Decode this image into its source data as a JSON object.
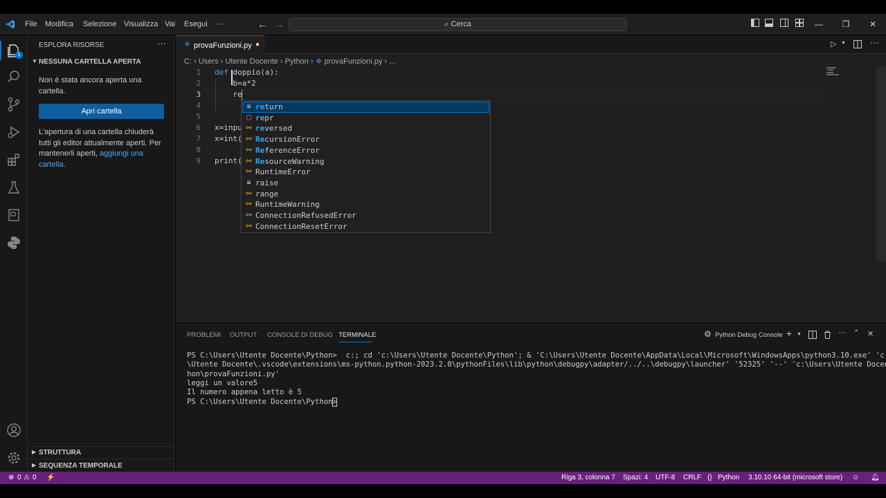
{
  "titlebar": {
    "menus": [
      "File",
      "Modifica",
      "Selezione",
      "Visualizza",
      "Vai",
      "Esegui",
      "···"
    ],
    "search_placeholder": "Cerca"
  },
  "sidebar": {
    "header": "ESPLORA RISORSE",
    "section_title": "NESSUNA CARTELLA APERTA",
    "message": "Non è stata ancora aperta una cartella.",
    "open_button": "Apri cartella",
    "note_prefix": "L'apertura di una cartella chiuderà tutti gli editor attualmente aperti. Per mantenerli aperti, ",
    "note_link": "aggiungi una cartella",
    "note_suffix": ".",
    "outline": "STRUTTURA",
    "timeline": "SEQUENZA TEMPORALE"
  },
  "editor": {
    "tab_label": "provaFunzioni.py",
    "breadcrumb": [
      "C:",
      "Users",
      "Utente Docente",
      "Python",
      "provaFunzioni.py",
      "..."
    ],
    "line_numbers": [
      "1",
      "2",
      "3",
      "4",
      "5",
      "6",
      "7",
      "8",
      "9"
    ],
    "code": {
      "l1_kw": "def",
      "l1_rest": " doppio(a):",
      "l2": "    b=a*2",
      "l3": "    re",
      "l6": "x=inpu",
      "l7": "x=int(",
      "l9": "print("
    }
  },
  "suggestions": [
    {
      "m": "re",
      "r": "turn",
      "icon": "keyword"
    },
    {
      "m": "re",
      "r": "pr",
      "icon": "function"
    },
    {
      "m": "re",
      "r": "versed",
      "icon": "class"
    },
    {
      "m": "Re",
      "r": "cursionError",
      "icon": "class"
    },
    {
      "m": "Re",
      "r": "ferenceError",
      "icon": "class"
    },
    {
      "m": "Re",
      "r": "sourceWarning",
      "icon": "class"
    },
    {
      "m": "",
      "r": "RuntimeError",
      "icon": "class"
    },
    {
      "m": "",
      "r": "raise",
      "icon": "keyword"
    },
    {
      "m": "",
      "r": "range",
      "icon": "class"
    },
    {
      "m": "",
      "r": "RuntimeWarning",
      "icon": "class"
    },
    {
      "m": "",
      "r": "ConnectionRefusedError",
      "icon": "class"
    },
    {
      "m": "",
      "r": "ConnectionResetError",
      "icon": "class"
    }
  ],
  "panel": {
    "tabs": [
      "PROBLEMI",
      "OUTPUT",
      "CONSOLE DI DEBUG",
      "TERMINALE"
    ],
    "debug_console": "Python Debug Console",
    "terminal_lines": [
      "PS C:\\Users\\Utente Docente\\Python>  c:; cd 'c:\\Users\\Utente Docente\\Python'; & 'C:\\Users\\Utente Docente\\AppData\\Local\\Microsoft\\WindowsApps\\python3.10.exe' 'c:\\Users",
      "\\Utente Docente\\.vscode\\extensions\\ms-python.python-2023.2.0\\pythonFiles\\lib\\python\\debugpy\\adapter/../..\\debugpy\\launcher' '52325' '--' 'c:\\Users\\Utente Docente\\Pyt",
      "hon\\provaFunzioni.py'",
      "leggi un valore5",
      "Il numero appena letto è 5",
      "PS C:\\Users\\Utente Docente\\Python> "
    ]
  },
  "status": {
    "errors": "0",
    "warnings": "0",
    "position": "Riga 3, colonna 7",
    "spaces": "Spazi: 4",
    "encoding": "UTF-8",
    "eol": "CRLF",
    "language": "Python",
    "interpreter": "3.10.10 64-bit (microsoft store)"
  },
  "colors": {
    "statusbar": "#68217a",
    "accent": "#0078d4",
    "button": "#0e5ea0"
  }
}
